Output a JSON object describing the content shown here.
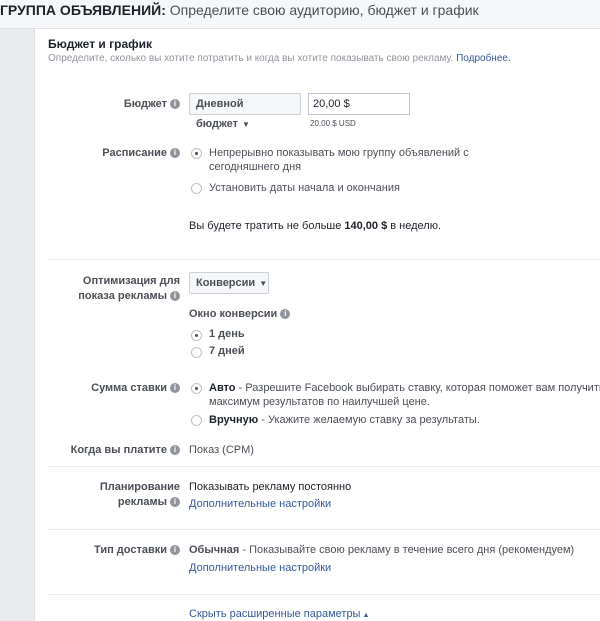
{
  "header": {
    "title_bold": "ГРУППА ОБЪЯВЛЕНИЙ:",
    "title_rest": " Определите свою аудиторию, бюджет и график"
  },
  "section": {
    "title": "Бюджет и график",
    "subtitle": "Определите, сколько вы хотите потратить и когда вы хотите показывать свою рекламу. ",
    "subtitle_link": "Подробнее."
  },
  "budget": {
    "label": "Бюджет",
    "dropdown": "Дневной бюджет",
    "value": "20,00 $",
    "hint": "20,00 $ USD"
  },
  "schedule": {
    "label": "Расписание",
    "option1_line1": "Непрерывно показывать мою группу объявлений с",
    "option1_line2": "сегодняшнего дня",
    "option2": "Установить даты начала и окончания",
    "spend_pre": "Вы будете тратить не больше ",
    "spend_amount": "140,00 $",
    "spend_post": " в неделю."
  },
  "optimization": {
    "label_line1": "Оптимизация для",
    "label_line2": "показа рекламы",
    "dropdown": "Конверсии",
    "window_label": "Окно конверсии",
    "option1": "1 день",
    "option2": "7 дней"
  },
  "bid": {
    "label": "Сумма ставки",
    "auto_title": "Авто",
    "auto_desc_line1": " - Разрешите Facebook выбирать ставку, которая поможет вам получить",
    "auto_desc_line2": "максимум результатов по наилучшей цене.",
    "manual_title": "Вручную",
    "manual_desc": " - Укажите желаемую ставку за результаты."
  },
  "payment": {
    "label": "Когда вы платите",
    "value": "Показ (CPM)"
  },
  "ad_scheduling": {
    "label_line1": "Планирование",
    "label_line2": "рекламы",
    "value": "Показывать рекламу постоянно",
    "link": "Дополнительные настройки"
  },
  "delivery": {
    "label": "Тип доставки",
    "title": "Обычная",
    "desc": " - Показывайте свою рекламу в течение всего дня (рекомендуем)",
    "link": "Дополнительные настройки"
  },
  "footer": {
    "hide_link": "Скрыть расширенные параметры"
  }
}
